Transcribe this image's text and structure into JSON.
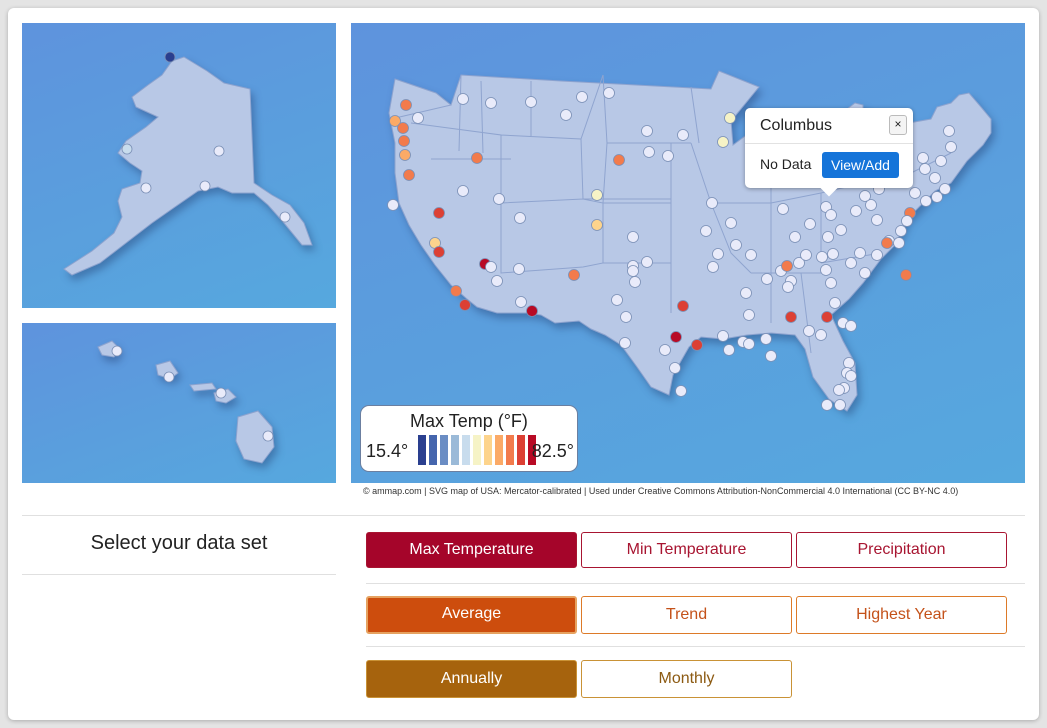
{
  "legend": {
    "title": "Max Temp (°F)",
    "min_label": "15.4°",
    "max_label": "82.5°",
    "swatches": [
      "#2a3f8f",
      "#4565ad",
      "#6b8dc4",
      "#9bbad8",
      "#c8dced",
      "#f6f3c6",
      "#fdd48c",
      "#fbaa67",
      "#f27b4c",
      "#dc4034",
      "#b80a25"
    ]
  },
  "popup": {
    "title": "Columbus",
    "close_icon": "×",
    "status": "No Data",
    "action_label": "View/Add"
  },
  "credit": "© ammap.com | SVG map of USA: Mercator-calibrated | Used under Creative Commons Attribution-NonCommercial 4.0 International (CC BY-NC 4.0)",
  "controls": {
    "section_label": "Select your data set",
    "dataset_buttons": [
      {
        "label": "Max Temperature",
        "active": true
      },
      {
        "label": "Min Temperature",
        "active": false
      },
      {
        "label": "Precipitation",
        "active": false
      }
    ],
    "metric_buttons": [
      {
        "label": "Average",
        "active": true
      },
      {
        "label": "Trend",
        "active": false
      },
      {
        "label": "Highest Year",
        "active": false
      }
    ],
    "period_buttons": [
      {
        "label": "Annually",
        "active": true
      },
      {
        "label": "Monthly",
        "active": false
      }
    ]
  },
  "colors": {
    "no_data_dot": "#e9ebfa",
    "ocean": "#5a9fdd",
    "land": "#b8c8e6",
    "dataset_active": "#a5052a",
    "metric_active": "#cd4d0d",
    "period_active": "#a6630d",
    "popup_button": "#1574d9"
  }
}
